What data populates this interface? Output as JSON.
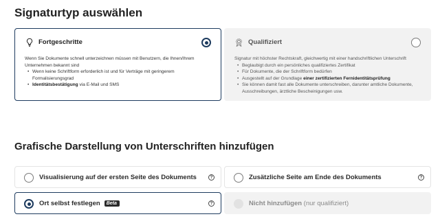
{
  "section1": {
    "title": "Signaturtyp auswählen"
  },
  "cards": {
    "advanced": {
      "title": "Fortgeschritte",
      "intro": "Wenn Sie Dokumente schnell unterzeichnen müssen mit Benutzern, die Ihnen/Ihrem Unternehmen bekannt sind",
      "bullet1": "Wenn keine Schriftform erforderlich ist und für Verträge mit geringerem Formalisierungsgrad",
      "bullet2_bold": "Identitätsbestätigung",
      "bullet2_rest": " via E-Mail und SMS",
      "icon": "lightbulb-icon",
      "selected": true
    },
    "qualified": {
      "title": "Qualifiziert",
      "intro": "Signatur mit höchster Rechtskraft, gleichwertig mit einer handschriftlichen Unterschrift",
      "bullet1": "Beglaubigt durch ein persönliches qualifiziertes Zertifikat",
      "bullet2": "Für Dokumente, die der Schriftform bedürfen",
      "bullet3_pre": "Ausgestellt auf der Grundlage ",
      "bullet3_bold": "einer zertifizierten Fernidentitätsprüfung",
      "bullet4": "Sie können damit fast alle Dokumente unterschreiben, darunter amtliche Dokumente, Ausschreibungen, ärztliche Bescheinigungen usw.",
      "icon": "certificate-icon",
      "selected": false
    }
  },
  "section2": {
    "title": "Grafische Darstellung von Unterschriften hinzufügen"
  },
  "options": {
    "first_page": {
      "label": "Visualisierung auf der ersten Seite des Dokuments",
      "selected": false
    },
    "extra_page": {
      "label": "Zusätzliche Seite am Ende des Dokuments",
      "selected": false
    },
    "custom": {
      "label": "Ort selbst festlegen",
      "badge": "Beta",
      "selected": true
    },
    "none": {
      "label": "Nicht hinzufügen",
      "note": " (nur qualifiziert)",
      "disabled": true
    }
  },
  "help_glyph": "?",
  "colors": {
    "accent": "#1c3a5e",
    "muted_bg": "#f2f2f2"
  }
}
